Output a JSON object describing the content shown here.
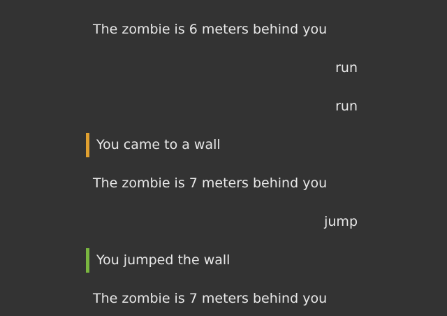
{
  "colors": {
    "background": "#333333",
    "text": "#e8e8e8",
    "warning_bar": "#e0a030",
    "success_bar": "#7ab640"
  },
  "log": [
    {
      "kind": "narration",
      "text": "The zombie is 6 meters behind you"
    },
    {
      "kind": "command",
      "text": "run"
    },
    {
      "kind": "command",
      "text": "run"
    },
    {
      "kind": "event",
      "status": "warning",
      "text": "You came to a wall"
    },
    {
      "kind": "narration",
      "text": "The zombie is 7 meters behind you"
    },
    {
      "kind": "command",
      "text": "jump"
    },
    {
      "kind": "event",
      "status": "success",
      "text": "You jumped the wall"
    },
    {
      "kind": "narration",
      "text": "The zombie is 7 meters behind you"
    }
  ]
}
